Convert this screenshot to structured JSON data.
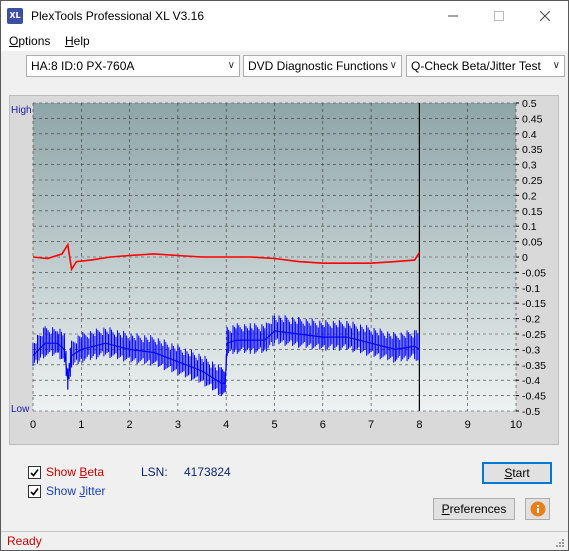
{
  "window": {
    "title": "PlexTools Professional XL V3.16",
    "icon_text": "XL"
  },
  "menu": {
    "options": {
      "mnemonic": "O",
      "rest": "ptions"
    },
    "help": {
      "mnemonic": "H",
      "rest": "elp"
    }
  },
  "toolbar": {
    "drive_select": "HA:8 ID:0  PX-760A",
    "function_select": "DVD Diagnostic Functions",
    "test_select": "Q-Check Beta/Jitter Test"
  },
  "chart_data": {
    "type": "line",
    "x_range": [
      0,
      10
    ],
    "x_ticks": [
      "0",
      "1",
      "2",
      "3",
      "4",
      "5",
      "6",
      "7",
      "8",
      "9",
      "10"
    ],
    "y_range": [
      -0.5,
      0.5
    ],
    "y_ticks": [
      "0.5",
      "0.45",
      "0.4",
      "0.35",
      "0.3",
      "0.25",
      "0.2",
      "0.15",
      "0.1",
      "0.05",
      "0",
      "-0.05",
      "-0.1",
      "-0.15",
      "-0.2",
      "-0.25",
      "-0.3",
      "-0.35",
      "-0.4",
      "-0.45",
      "-0.5"
    ],
    "left_labels": {
      "top": "High",
      "bottom": "Low"
    },
    "grid": true,
    "end_marker_x": 8,
    "series": [
      {
        "color": "#ff0000",
        "x": [
          0,
          0.3,
          0.6,
          0.72,
          0.8,
          0.9,
          1.2,
          1.6,
          2,
          2.5,
          3,
          3.5,
          4,
          4.5,
          5,
          5.5,
          6,
          6.5,
          7,
          7.5,
          7.9,
          8
        ],
        "y": [
          0.0,
          -0.005,
          0.01,
          0.04,
          -0.04,
          -0.015,
          -0.01,
          0.0,
          0.005,
          0.01,
          0.005,
          0.0,
          0.0,
          0.0,
          -0.005,
          -0.015,
          -0.02,
          -0.02,
          -0.02,
          -0.015,
          -0.01,
          0.015
        ]
      },
      {
        "color": "#0000ff",
        "x": [
          0,
          0.25,
          0.5,
          0.65,
          0.72,
          0.8,
          1,
          1.5,
          2,
          2.5,
          3,
          3.5,
          3.9,
          3.98,
          4.02,
          4.2,
          4.5,
          4.8,
          5,
          5.5,
          6,
          6.5,
          7,
          7.5,
          7.9,
          8
        ],
        "y": [
          -0.32,
          -0.28,
          -0.28,
          -0.3,
          -0.4,
          -0.32,
          -0.3,
          -0.28,
          -0.3,
          -0.31,
          -0.34,
          -0.37,
          -0.41,
          -0.41,
          -0.28,
          -0.27,
          -0.27,
          -0.27,
          -0.24,
          -0.25,
          -0.26,
          -0.26,
          -0.28,
          -0.3,
          -0.29,
          -0.3
        ]
      }
    ]
  },
  "controls": {
    "show_beta": {
      "mnemonic_prefix": "Show ",
      "mnemonic": "B",
      "rest": "eta",
      "checked": true,
      "color": "#cc0000"
    },
    "show_jitter": {
      "mnemonic_prefix": "Show ",
      "mnemonic": "J",
      "rest": "itter",
      "checked": true,
      "color": "#0000cc"
    },
    "lsn_label": "LSN:",
    "lsn_value": "4173824",
    "start_button": {
      "mnemonic": "S",
      "rest": "tart"
    },
    "preferences_button": {
      "mnemonic": "P",
      "rest": "references"
    }
  },
  "status": {
    "text": "Ready"
  }
}
